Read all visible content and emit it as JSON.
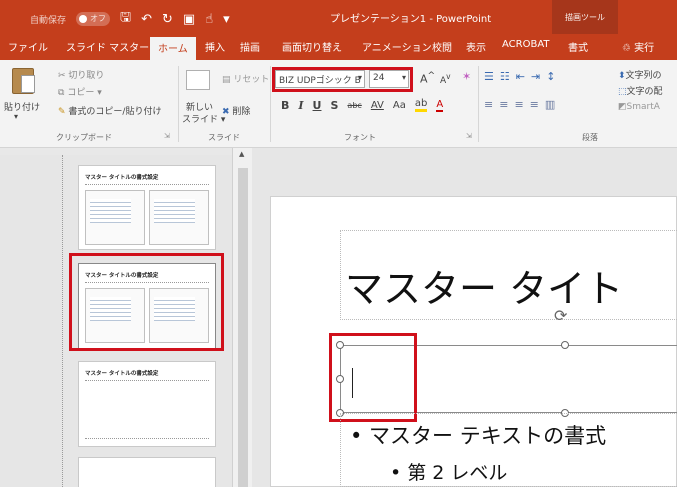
{
  "titlebar": {
    "autosave_label": "自動保存",
    "autosave_state": "オフ",
    "title": "プレゼンテーション1 - PowerPoint",
    "context_tool": "描画ツール"
  },
  "tabs": [
    {
      "label": "ファイル"
    },
    {
      "label": "スライド マスター"
    },
    {
      "label": "ホーム",
      "active": true
    },
    {
      "label": "挿入"
    },
    {
      "label": "描画"
    },
    {
      "label": "画面切り替え"
    },
    {
      "label": "アニメーション"
    },
    {
      "label": "校閲"
    },
    {
      "label": "表示"
    },
    {
      "label": "ACROBAT"
    },
    {
      "label": "書式"
    },
    {
      "label": "実行"
    }
  ],
  "ribbon": {
    "clipboard": {
      "paste": "貼り付け",
      "cut": "切り取り",
      "copy": "コピー",
      "format_painter": "書式のコピー/貼り付け",
      "label": "クリップボード"
    },
    "slides": {
      "reset": "リセット",
      "new_slide_1": "新しい",
      "new_slide_2": "スライド",
      "delete": "削除",
      "label": "スライド"
    },
    "font": {
      "font_name": "BIZ UDPゴシック B",
      "font_size": "24",
      "bold": "B",
      "italic": "I",
      "underline": "U",
      "shadow": "S",
      "strike": "abc",
      "spacing": "AV",
      "case": "Aa",
      "highlight": "ab",
      "color": "A",
      "grow": "A",
      "shrink": "A",
      "label": "フォント"
    },
    "paragraph": {
      "text_direction": "文字列の",
      "align_text": "文字の配",
      "smartart": "SmartA",
      "label": "段落"
    }
  },
  "thumbnails": [
    {
      "title": "マスター タイトルの書式設定"
    },
    {
      "title": "マスター タイトルの書式設定"
    },
    {
      "title": "マスター タイトルの書式設定"
    }
  ],
  "slide": {
    "title": "マスター タイト",
    "bullet1": "• マスター テキストの書式",
    "bullet2": "• 第 2 レベル"
  },
  "colors": {
    "brand": "#c43e1c",
    "highlight_box": "#d0101b"
  }
}
